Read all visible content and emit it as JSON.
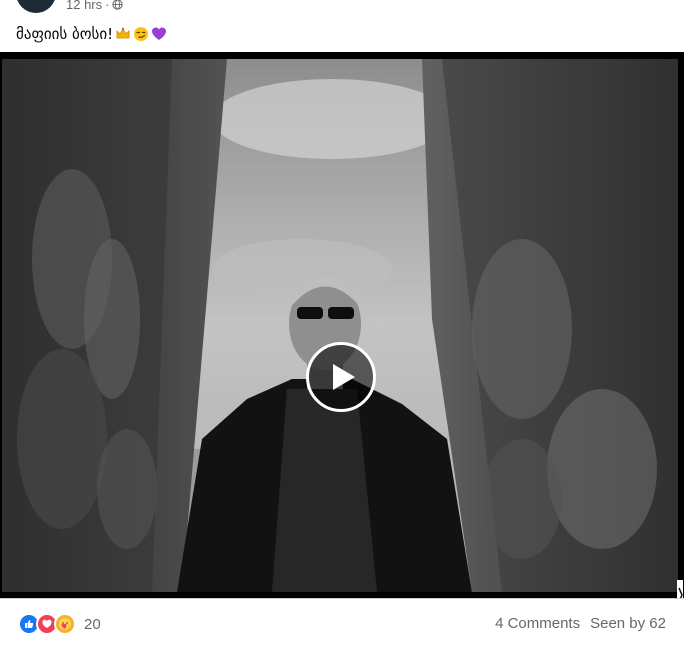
{
  "post": {
    "time": "12 hrs",
    "separator": "·",
    "privacy_icon": "globe-icon",
    "caption_text": "მაფიის ბოსი!",
    "caption_emojis": [
      "crown-emoji",
      "smirk-emoji",
      "purple-heart-emoji"
    ]
  },
  "video": {
    "play_icon": "play-icon"
  },
  "footer": {
    "reaction_icons": [
      "like-icon",
      "love-icon",
      "care-icon"
    ],
    "reaction_count": "20",
    "comments": "4 Comments",
    "seen": "Seen by 62"
  },
  "colors": {
    "like": "#1877f2",
    "love": "#f33e58",
    "care": "#f7b125",
    "secondary_text": "#65676b"
  }
}
